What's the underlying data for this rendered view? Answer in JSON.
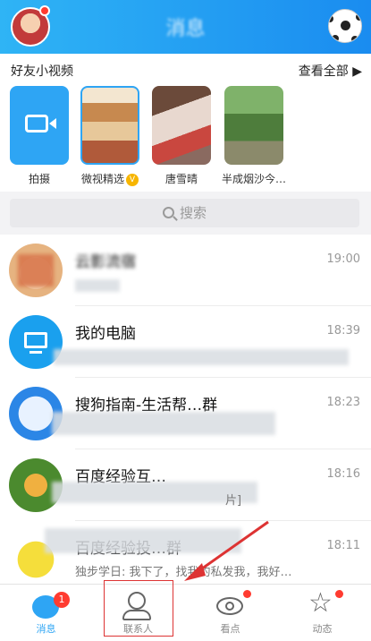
{
  "header": {
    "title": "消息"
  },
  "friend_videos": {
    "title": "好友小视频",
    "view_all": "查看全部 ▶",
    "tiles": [
      {
        "label": "拍摄"
      },
      {
        "label": "微视精选",
        "badge": "V"
      },
      {
        "label": "唐雪晴"
      },
      {
        "label": "半成烟沙今…"
      }
    ]
  },
  "search": {
    "placeholder": "搜索"
  },
  "chats": [
    {
      "name": "云影流宿",
      "time": "19:00",
      "message": ""
    },
    {
      "name": "我的电脑",
      "time": "18:39",
      "message": ""
    },
    {
      "name": "搜狗指南-生活帮…群",
      "time": "18:23",
      "message": ""
    },
    {
      "name": "百度经验互…",
      "time": "18:16",
      "message": "片]"
    },
    {
      "name": "百度经验投…群",
      "time": "18:11",
      "message": "独步学日: 我下了，找我的私发我，我好…"
    }
  ],
  "tabs": [
    {
      "label": "消息",
      "badge": "1"
    },
    {
      "label": "联系人"
    },
    {
      "label": "看点"
    },
    {
      "label": "动态"
    }
  ],
  "colors": {
    "accent": "#1a8cf0",
    "badge": "#ff3b30",
    "highlight": "#dd3333"
  }
}
